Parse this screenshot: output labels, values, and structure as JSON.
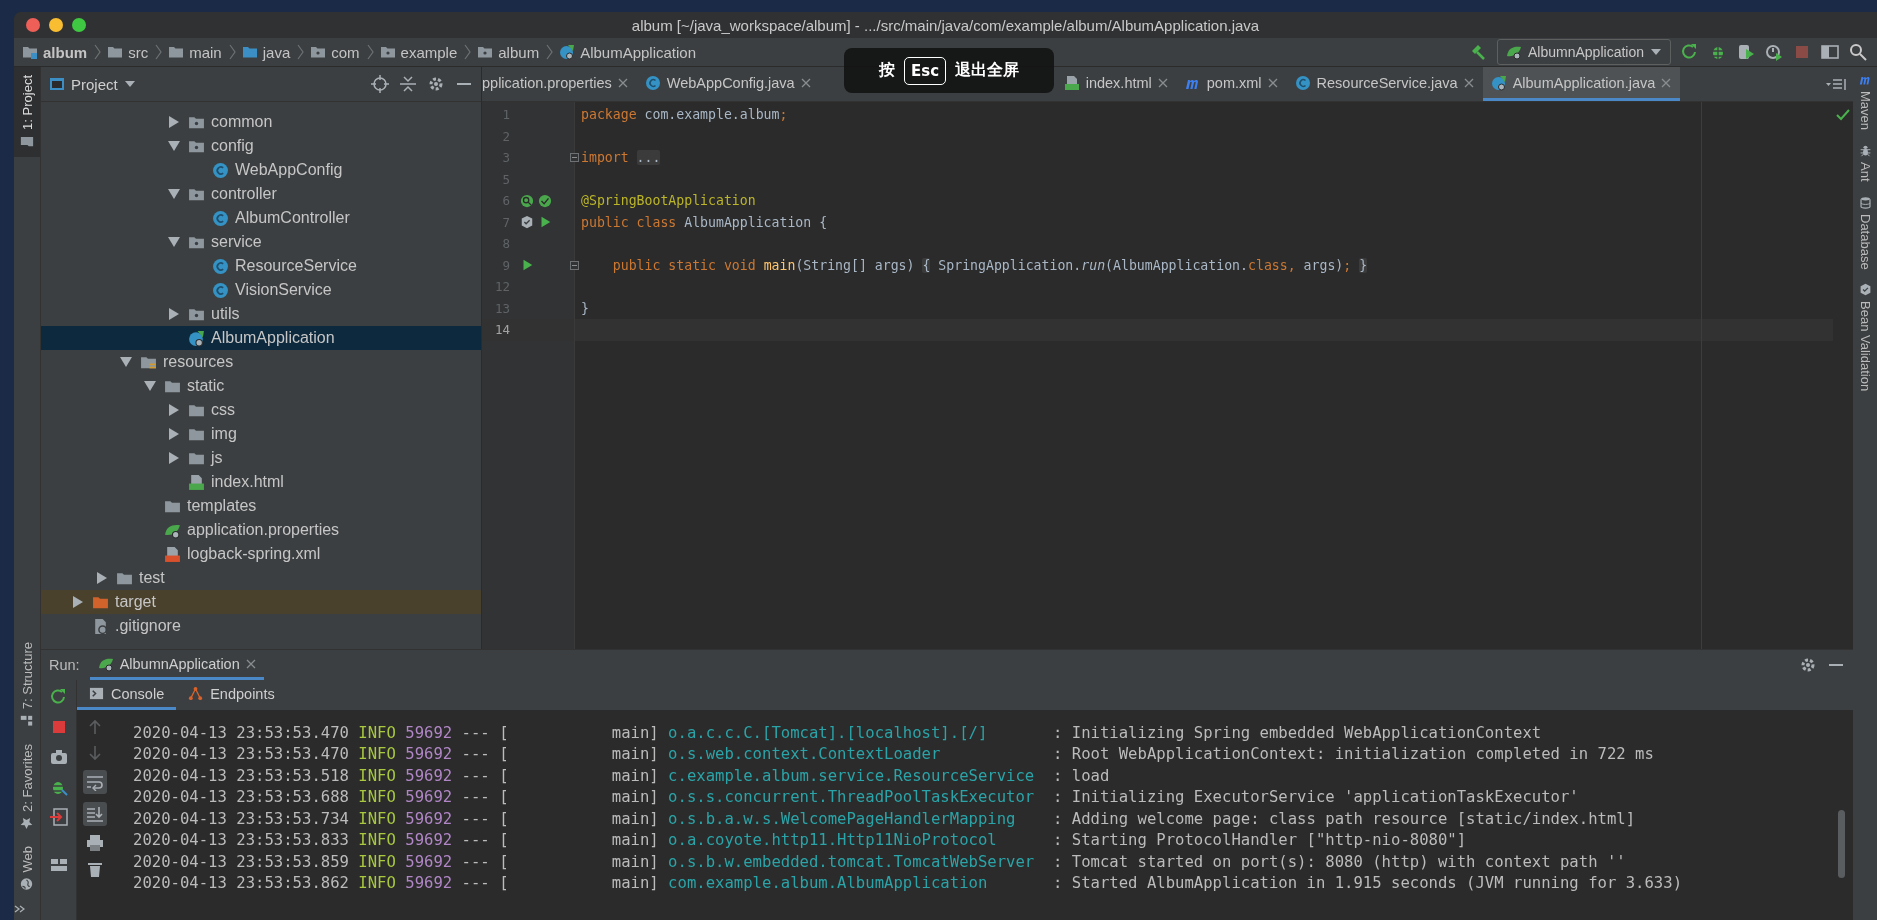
{
  "window": {
    "title": "album [~/java_workspace/album] - .../src/main/java/com/example/album/AlbumApplication.java"
  },
  "breadcrumbs": [
    {
      "label": "album",
      "kind": "module"
    },
    {
      "label": "src",
      "kind": "folder"
    },
    {
      "label": "main",
      "kind": "folder"
    },
    {
      "label": "java",
      "kind": "source-folder"
    },
    {
      "label": "com",
      "kind": "package"
    },
    {
      "label": "example",
      "kind": "package"
    },
    {
      "label": "album",
      "kind": "package"
    },
    {
      "label": "AlbumApplication",
      "kind": "spring-class"
    }
  ],
  "run_config": {
    "label": "AlbumnApplication"
  },
  "fullscreen_hint": {
    "before": "按",
    "key": "Esc",
    "after": "退出全屏"
  },
  "left_strip": {
    "top": [
      {
        "label": "1: Project",
        "selected": true
      }
    ],
    "bottom": [
      {
        "label": "7: Structure",
        "kind": "structure",
        "selected": false
      },
      {
        "label": "2: Favorites",
        "kind": "favorites",
        "selected": false
      },
      {
        "label": "Web",
        "kind": "web",
        "selected": false
      }
    ]
  },
  "right_strip": [
    {
      "label": "Maven",
      "kind": "maven"
    },
    {
      "label": "Ant",
      "kind": "ant"
    },
    {
      "label": "Database",
      "kind": "database"
    },
    {
      "label": "Bean Validation",
      "kind": "bean"
    }
  ],
  "project": {
    "title": "Project",
    "tree": [
      {
        "children": [
          {
            "children": [
              {
                "children": [
                  {
                    "children": [
                      {
                        "label": "common",
                        "kind": "package",
                        "expanded": false,
                        "selected": false
                      },
                      {
                        "label": "config",
                        "kind": "package",
                        "expanded": true,
                        "selected": false,
                        "children": [
                          {
                            "label": "WebAppConfig",
                            "kind": "class",
                            "selected": false
                          }
                        ]
                      },
                      {
                        "label": "controller",
                        "kind": "package",
                        "expanded": true,
                        "selected": false,
                        "children": [
                          {
                            "label": "AlbumController",
                            "kind": "class",
                            "selected": false
                          }
                        ]
                      },
                      {
                        "label": "service",
                        "kind": "package",
                        "expanded": true,
                        "selected": false,
                        "children": [
                          {
                            "label": "ResourceService",
                            "kind": "class",
                            "selected": false
                          },
                          {
                            "label": "VisionService",
                            "kind": "class",
                            "selected": false
                          }
                        ]
                      },
                      {
                        "label": "utils",
                        "kind": "package",
                        "expanded": false,
                        "selected": false
                      },
                      {
                        "label": "AlbumApplication",
                        "kind": "spring-class",
                        "selected": true
                      }
                    ]
                  }
                ]
              },
              {
                "label": "resources",
                "kind": "resources",
                "expanded": true,
                "selected": false,
                "children": [
                  {
                    "label": "static",
                    "kind": "folder",
                    "expanded": true,
                    "selected": false,
                    "children": [
                      {
                        "label": "css",
                        "kind": "folder",
                        "expanded": false,
                        "selected": false
                      },
                      {
                        "label": "img",
                        "kind": "folder",
                        "expanded": false,
                        "selected": false
                      },
                      {
                        "label": "js",
                        "kind": "folder",
                        "expanded": false,
                        "selected": false
                      },
                      {
                        "label": "index.html",
                        "kind": "html",
                        "selected": false
                      }
                    ]
                  },
                  {
                    "label": "templates",
                    "kind": "folder",
                    "selected": false
                  },
                  {
                    "label": "application.properties",
                    "kind": "properties",
                    "selected": false
                  },
                  {
                    "label": "logback-spring.xml",
                    "kind": "xml",
                    "selected": false
                  }
                ]
              }
            ]
          },
          {
            "label": "test",
            "kind": "folder",
            "expanded": false,
            "selected": false
          }
        ]
      },
      {
        "label": "target",
        "kind": "excluded-folder",
        "expanded": false,
        "selected": false
      },
      {
        "label": ".gitignore",
        "kind": "gitignore",
        "selected": false
      }
    ]
  },
  "editor": {
    "tabs": [
      {
        "label": "pplication.properties",
        "selected": false
      },
      {
        "label": "WebAppConfig.java",
        "kind": "class",
        "selected": false
      },
      {
        "label": "index.html",
        "kind": "html",
        "selected": false
      },
      {
        "label": "pom.xml",
        "kind": "maven",
        "selected": false
      },
      {
        "label": "ResourceService.java",
        "kind": "class",
        "selected": false
      },
      {
        "label": "AlbumApplication.java",
        "kind": "spring-class",
        "selected": true
      }
    ],
    "lines": [
      {
        "number": "1",
        "current": false,
        "fold": false,
        "tokens": [
          {
            "kind": "keyword",
            "text": "package"
          },
          {
            "kind": "plain",
            "text": " com.example.album"
          },
          {
            "kind": "keyword",
            "text": ";"
          }
        ]
      },
      {
        "number": "2",
        "current": false,
        "fold": false
      },
      {
        "number": "3",
        "current": false,
        "fold": true,
        "tokens": [
          {
            "kind": "keyword",
            "text": "import "
          },
          {
            "kind": "folded",
            "text": "..."
          }
        ]
      },
      {
        "number": "5",
        "current": false,
        "fold": false
      },
      {
        "number": "6",
        "current": false,
        "fold": false,
        "gutter": [
          {
            "kind": "bean-search"
          },
          {
            "kind": "bean-check"
          }
        ],
        "tokens": [
          {
            "kind": "annotation",
            "text": "@SpringBootApplication"
          }
        ]
      },
      {
        "number": "7",
        "current": false,
        "fold": false,
        "gutter": [
          {
            "kind": "bean"
          },
          {
            "kind": "run"
          }
        ],
        "tokens": [
          {
            "kind": "keyword",
            "text": "public class"
          },
          {
            "kind": "plain",
            "text": " AlbumApplication {"
          }
        ]
      },
      {
        "number": "8",
        "current": false,
        "fold": false
      },
      {
        "number": "9",
        "current": false,
        "fold": true,
        "gutter": [
          {
            "kind": "run"
          }
        ],
        "tokens": [
          {
            "kind": "keyword",
            "text": "    public static void "
          },
          {
            "kind": "method",
            "text": "main"
          },
          {
            "kind": "plain",
            "text": "(String[] args) "
          },
          {
            "kind": "folded",
            "text": "{"
          },
          {
            "kind": "plain",
            "text": " SpringApplication."
          },
          {
            "kind": "static",
            "text": "run"
          },
          {
            "kind": "plain",
            "text": "(AlbumApplication."
          },
          {
            "kind": "keyword",
            "text": "class,"
          },
          {
            "kind": "plain",
            "text": " args)"
          },
          {
            "kind": "keyword",
            "text": "; "
          },
          {
            "kind": "folded",
            "text": "}"
          }
        ]
      },
      {
        "number": "12",
        "current": false,
        "fold": false
      },
      {
        "number": "13",
        "current": false,
        "fold": false,
        "tokens": [
          {
            "kind": "plain",
            "text": "}"
          }
        ]
      },
      {
        "number": "14",
        "current": true,
        "fold": false
      }
    ]
  },
  "run": {
    "label": "Run:",
    "tab": {
      "label": "AlbumnApplication"
    },
    "subtabs": [
      {
        "label": "Console",
        "kind": "console",
        "selected": true
      },
      {
        "label": "Endpoints",
        "kind": "endpoints",
        "selected": false
      }
    ],
    "lines": [
      {
        "time": "2020-04-13 23:53:53.470",
        "level": "INFO",
        "pid": "59692",
        "sep": "---",
        "thread": "[           main]",
        "logger": "o.a.c.c.C.[Tomcat].[localhost].[/]",
        "message": ": Initializing Spring embedded WebApplicationContext"
      },
      {
        "time": "2020-04-13 23:53:53.470",
        "level": "INFO",
        "pid": "59692",
        "sep": "---",
        "thread": "[           main]",
        "logger": "o.s.web.context.ContextLoader",
        "message": ": Root WebApplicationContext: initialization completed in 722 ms"
      },
      {
        "time": "2020-04-13 23:53:53.518",
        "level": "INFO",
        "pid": "59692",
        "sep": "---",
        "thread": "[           main]",
        "logger": "c.example.album.service.ResourceService",
        "message": ": load"
      },
      {
        "time": "2020-04-13 23:53:53.688",
        "level": "INFO",
        "pid": "59692",
        "sep": "---",
        "thread": "[           main]",
        "logger": "o.s.s.concurrent.ThreadPoolTaskExecutor",
        "message": ": Initializing ExecutorService 'applicationTaskExecutor'"
      },
      {
        "time": "2020-04-13 23:53:53.734",
        "level": "INFO",
        "pid": "59692",
        "sep": "---",
        "thread": "[           main]",
        "logger": "o.s.b.a.w.s.WelcomePageHandlerMapping",
        "message": ": Adding welcome page: class path resource [static/index.html]"
      },
      {
        "time": "2020-04-13 23:53:53.833",
        "level": "INFO",
        "pid": "59692",
        "sep": "---",
        "thread": "[           main]",
        "logger": "o.a.coyote.http11.Http11NioProtocol",
        "message": ": Starting ProtocolHandler [\"http-nio-8080\"]"
      },
      {
        "time": "2020-04-13 23:53:53.859",
        "level": "INFO",
        "pid": "59692",
        "sep": "---",
        "thread": "[           main]",
        "logger": "o.s.b.w.embedded.tomcat.TomcatWebServer",
        "message": ": Tomcat started on port(s): 8080 (http) with context path ''"
      },
      {
        "time": "2020-04-13 23:53:53.862",
        "level": "INFO",
        "pid": "59692",
        "sep": "---",
        "thread": "[           main]",
        "logger": "com.example.album.AlbumApplication",
        "message": ": Started AlbumApplication in 1.915 seconds (JVM running for 3.633)"
      }
    ]
  }
}
